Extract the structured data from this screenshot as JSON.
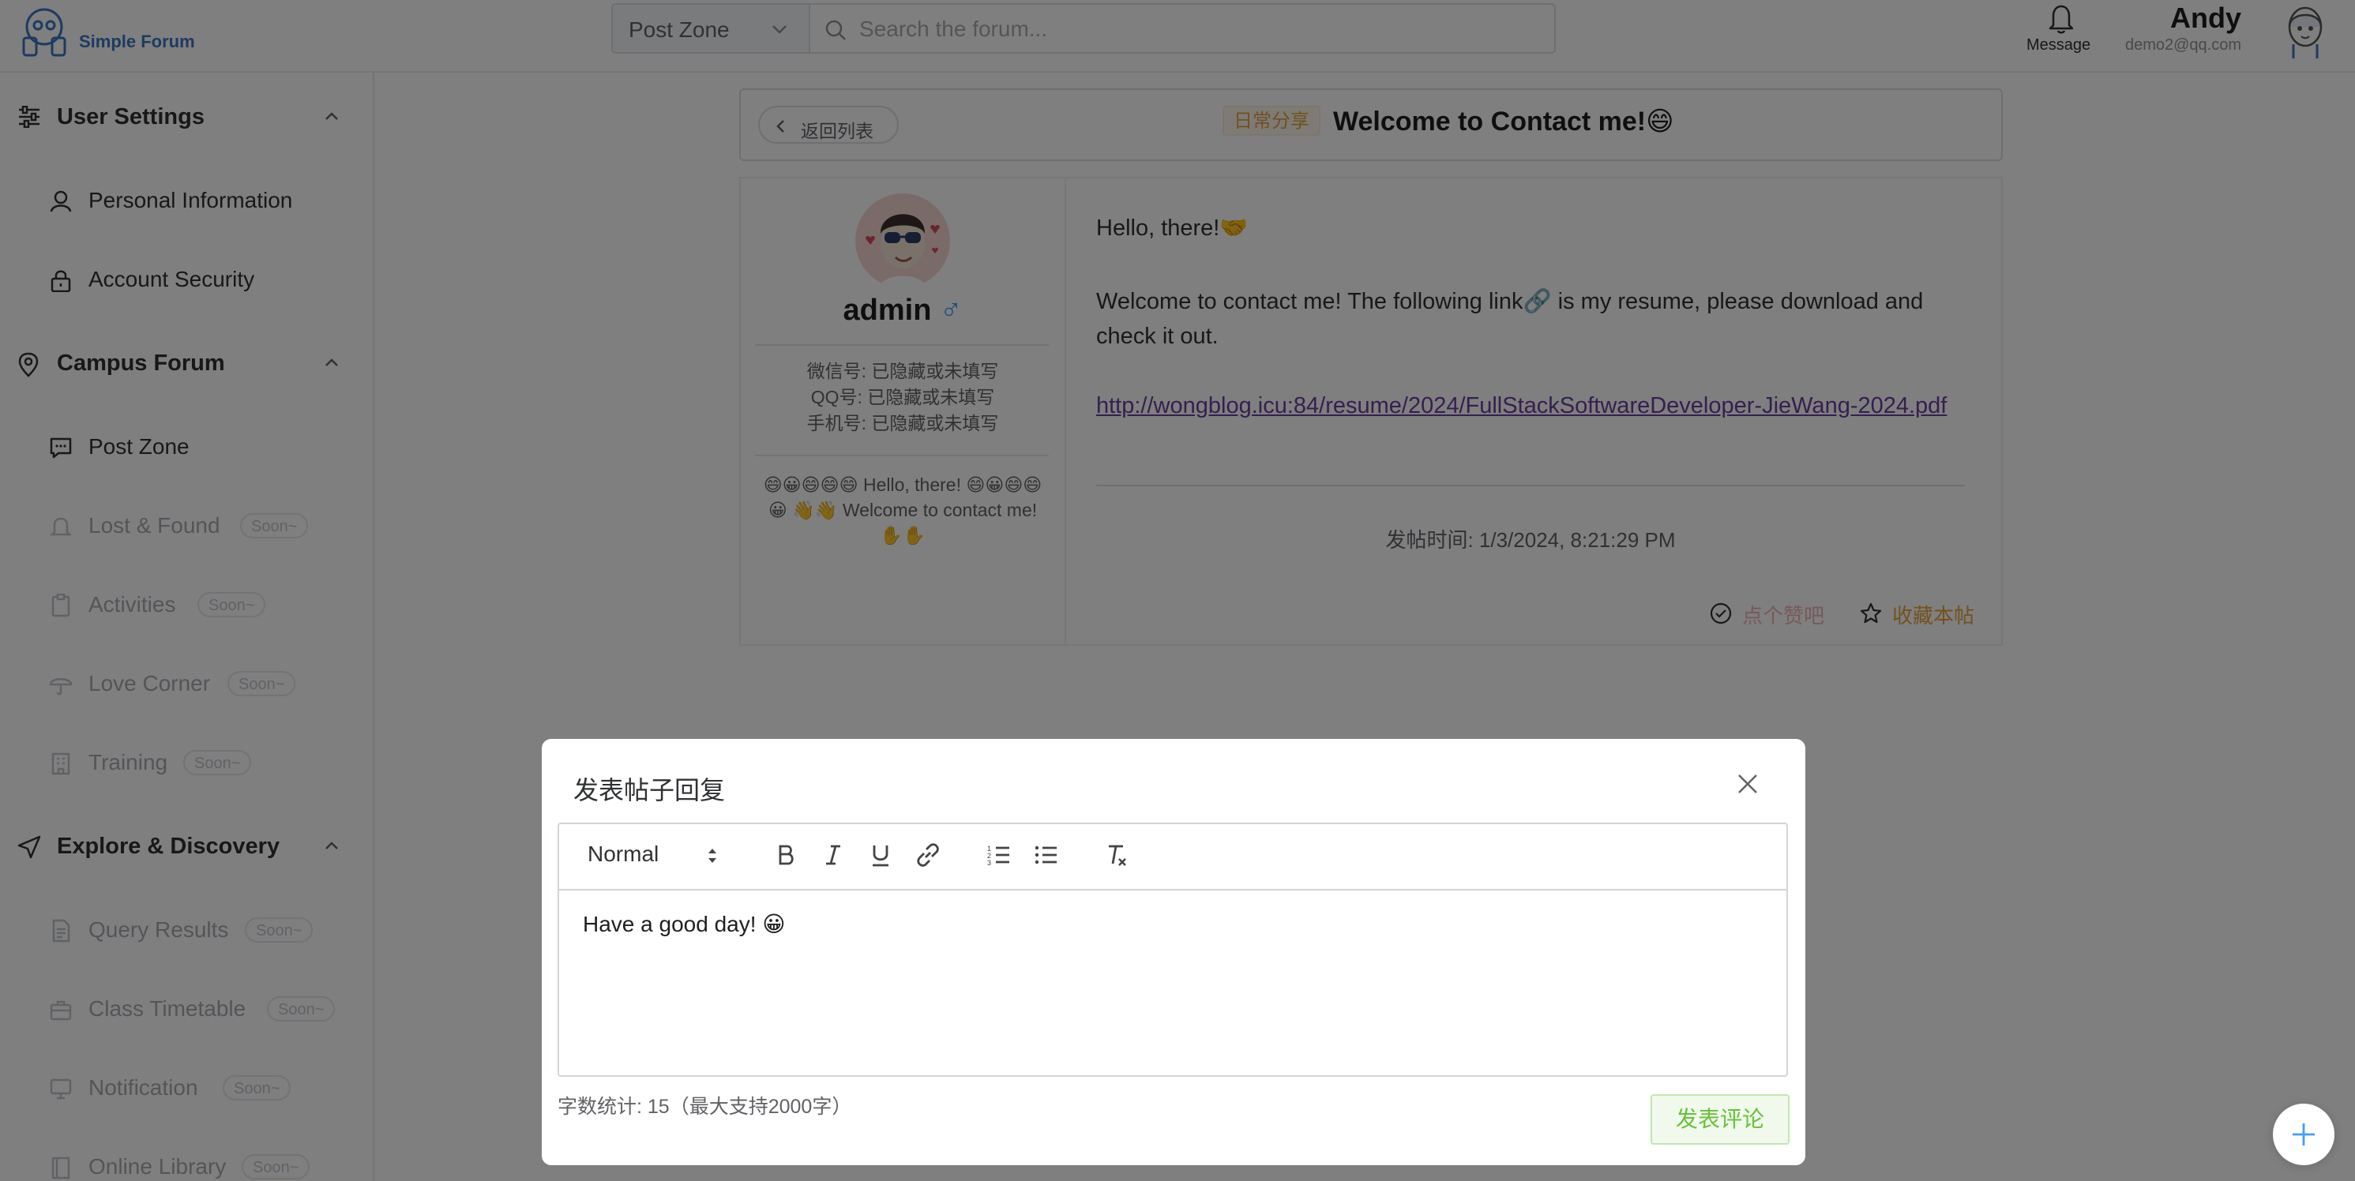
{
  "header": {
    "brand": "Simple Forum",
    "zone_select": "Post Zone",
    "search_placeholder": "Search the forum...",
    "message_label": "Message",
    "user_name": "Andy",
    "user_email": "demo2@qq.com"
  },
  "sidebar": {
    "groups": [
      {
        "label": "User Settings",
        "icon": "sliders-icon"
      },
      {
        "label": "Campus Forum",
        "icon": "location-pin-icon"
      },
      {
        "label": "Explore & Discovery",
        "icon": "navigation-arrow-icon"
      }
    ],
    "items": [
      {
        "label": "Personal Information",
        "icon": "user-icon"
      },
      {
        "label": "Account Security",
        "icon": "lock-icon"
      },
      {
        "label": "Post Zone",
        "icon": "chat-icon"
      },
      {
        "label": "Lost & Found",
        "icon": "bell-icon",
        "badge": "Soon~"
      },
      {
        "label": "Activities",
        "icon": "clipboard-icon",
        "badge": "Soon~"
      },
      {
        "label": "Love Corner",
        "icon": "umbrella-icon",
        "badge": "Soon~"
      },
      {
        "label": "Training",
        "icon": "building-icon",
        "badge": "Soon~"
      },
      {
        "label": "Query Results",
        "icon": "document-icon",
        "badge": "Soon~"
      },
      {
        "label": "Class Timetable",
        "icon": "briefcase-icon",
        "badge": "Soon~"
      },
      {
        "label": "Notification",
        "icon": "monitor-icon",
        "badge": "Soon~"
      },
      {
        "label": "Online Library",
        "icon": "book-icon",
        "badge": "Soon~"
      }
    ]
  },
  "post": {
    "back_label": "返回列表",
    "tag": "日常分享",
    "title": "Welcome to Contact me!😄",
    "author": {
      "name": "admin",
      "gender": "♂",
      "wechat": "微信号: 已隐藏或未填写",
      "qq": "QQ号: 已隐藏或未填写",
      "phone": "手机号: 已隐藏或未填写",
      "bio": "😄😀😄😄😄 Hello, there! 😄😀😄😄😀 👋👋 Welcome to contact me! ✋✋"
    },
    "body_greeting": "Hello, there!🤝",
    "body_text": "Welcome to contact me! The following link🔗 is my resume, please download and check it out.",
    "link": "http://wongblog.icu:84/resume/2024/FullStackSoftwareDeveloper-JieWang-2024.pdf",
    "post_time": "发帖时间: 1/3/2024, 8:21:29 PM",
    "like_label": "点个赞吧",
    "favorite_label": "收藏本帖"
  },
  "dialog": {
    "title": "发表帖子回复",
    "format_value": "Normal",
    "editor_content": "Have a good day! 😀",
    "char_count": "字数统计: 15（最大支持2000字）",
    "submit_label": "发表评论"
  }
}
